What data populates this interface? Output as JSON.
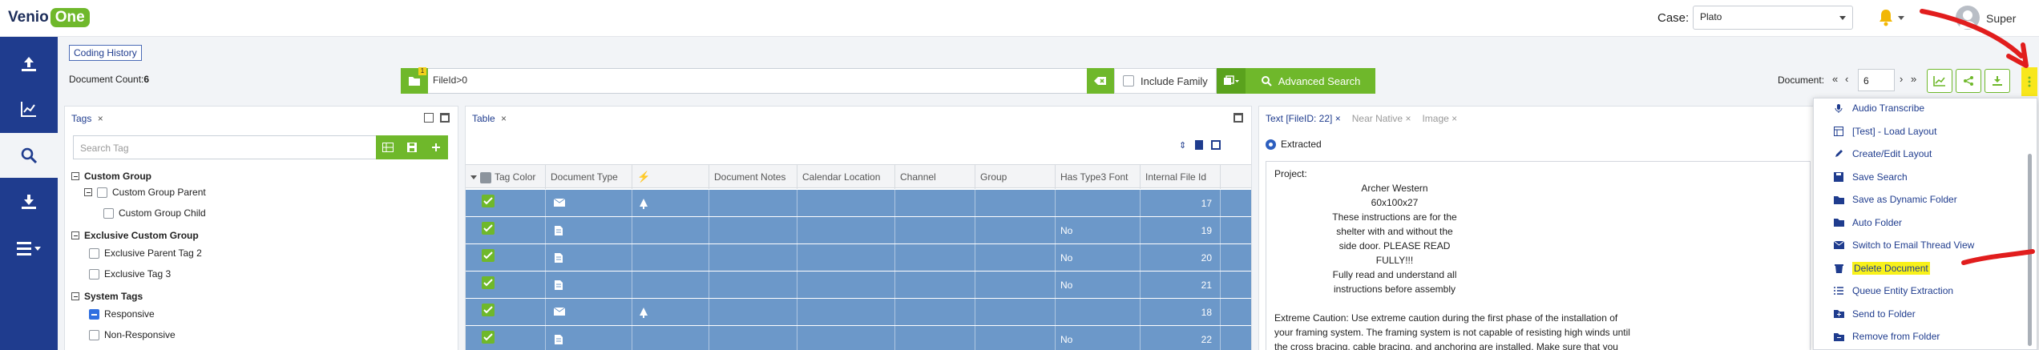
{
  "app": {
    "logo_main": "Venio",
    "logo_accent": "One"
  },
  "header": {
    "case_label": "Case:",
    "case_value": "Plato",
    "user_name": "Super"
  },
  "rail": {
    "items": [
      "upload-icon",
      "analytics-icon",
      "search-icon",
      "download-icon",
      "menu-icon"
    ],
    "active": "search-icon"
  },
  "coding_history": "Coding History",
  "toolbar": {
    "doc_count_label": "Document Count:",
    "doc_count_value": "6",
    "badge": "1",
    "query": "FileId>0",
    "include_family": "Include Family",
    "advanced_search": "Advanced Search",
    "document_label": "Document:",
    "document_value": "6"
  },
  "tags_panel": {
    "title": "Tags",
    "search_placeholder": "Search Tag",
    "tree": [
      {
        "label": "Custom Group",
        "level": 0,
        "group": true
      },
      {
        "label": "Custom Group Parent",
        "level": 1
      },
      {
        "label": "Custom Group Child",
        "level": 2
      },
      {
        "label": "Exclusive Custom Group",
        "level": 0,
        "group": true
      },
      {
        "label": "Exclusive Parent Tag 2",
        "level": 1
      },
      {
        "label": "Exclusive Tag 3",
        "level": 1
      },
      {
        "label": "System Tags",
        "level": 0,
        "group": true
      },
      {
        "label": "Responsive",
        "level": 1,
        "indeterminate": true
      },
      {
        "label": "Non-Responsive",
        "level": 1
      }
    ]
  },
  "table_panel": {
    "title": "Table",
    "columns": [
      "Tag Color",
      "Document Type",
      "",
      "Document Notes",
      "Calendar Location",
      "Channel",
      "Group",
      "Has Type3 Font",
      "Internal File Id"
    ],
    "rows": [
      {
        "type_icon": "email-icon",
        "extra_icon": "attachment-icon",
        "has_type3": "",
        "file_id": "17"
      },
      {
        "type_icon": "doc-icon",
        "extra_icon": "",
        "has_type3": "No",
        "file_id": "19"
      },
      {
        "type_icon": "doc-icon",
        "extra_icon": "",
        "has_type3": "No",
        "file_id": "20"
      },
      {
        "type_icon": "doc-icon",
        "extra_icon": "",
        "has_type3": "No",
        "file_id": "21"
      },
      {
        "type_icon": "email-icon",
        "extra_icon": "attachment-icon",
        "has_type3": "",
        "file_id": "18"
      },
      {
        "type_icon": "doc-icon",
        "extra_icon": "",
        "has_type3": "No",
        "file_id": "22"
      }
    ]
  },
  "text_panel": {
    "tabs": [
      "Text [FileID: 22]",
      "Near Native",
      "Image"
    ],
    "radio_label": "Extracted",
    "lines": [
      {
        "t": "Project:",
        "center": false
      },
      {
        "t": "Archer Western",
        "center": true
      },
      {
        "t": "60x100x27",
        "center": true
      },
      {
        "t": "These instructions are for the",
        "center": true
      },
      {
        "t": "shelter with and without the",
        "center": true
      },
      {
        "t": "side door. PLEASE READ",
        "center": true
      },
      {
        "t": "FULLY!!!",
        "center": true
      },
      {
        "t": "Fully read and understand all",
        "center": true
      },
      {
        "t": "instructions before assembly",
        "center": true
      },
      {
        "t": "",
        "center": false
      },
      {
        "t": "Extreme Caution: Use extreme caution during the first phase of the installation of",
        "center": false
      },
      {
        "t": "your framing system. The framing system is not capable of resisting high winds until",
        "center": false
      },
      {
        "t": "the cross bracing, cable bracing, and anchoring are installed. Make sure that you",
        "center": false
      }
    ]
  },
  "menu": {
    "items": [
      {
        "label": "Audio Transcribe",
        "icon": "audio-icon"
      },
      {
        "label": "[Test] - Load Layout",
        "icon": "layout-icon"
      },
      {
        "label": "Create/Edit Layout",
        "icon": "edit-icon"
      },
      {
        "label": "Save Search",
        "icon": "save-icon"
      },
      {
        "label": "Save as Dynamic Folder",
        "icon": "folder-icon"
      },
      {
        "label": "Auto Folder",
        "icon": "folder-icon"
      },
      {
        "label": "Switch to Email Thread View",
        "icon": "email-icon"
      },
      {
        "label": "Delete Document",
        "icon": "trash-icon",
        "highlight": true
      },
      {
        "label": "Queue Entity Extraction",
        "icon": "list-icon"
      },
      {
        "label": "Send to Folder",
        "icon": "folder-plus-icon"
      },
      {
        "label": "Remove from Folder",
        "icon": "folder-minus-icon"
      }
    ]
  },
  "colors": {
    "brand_blue": "#1f3c8e",
    "brand_green": "#6fb82b",
    "row_selected": "#6c98c9",
    "highlight": "#f8f11a",
    "annotation_red": "#e11d1d"
  }
}
